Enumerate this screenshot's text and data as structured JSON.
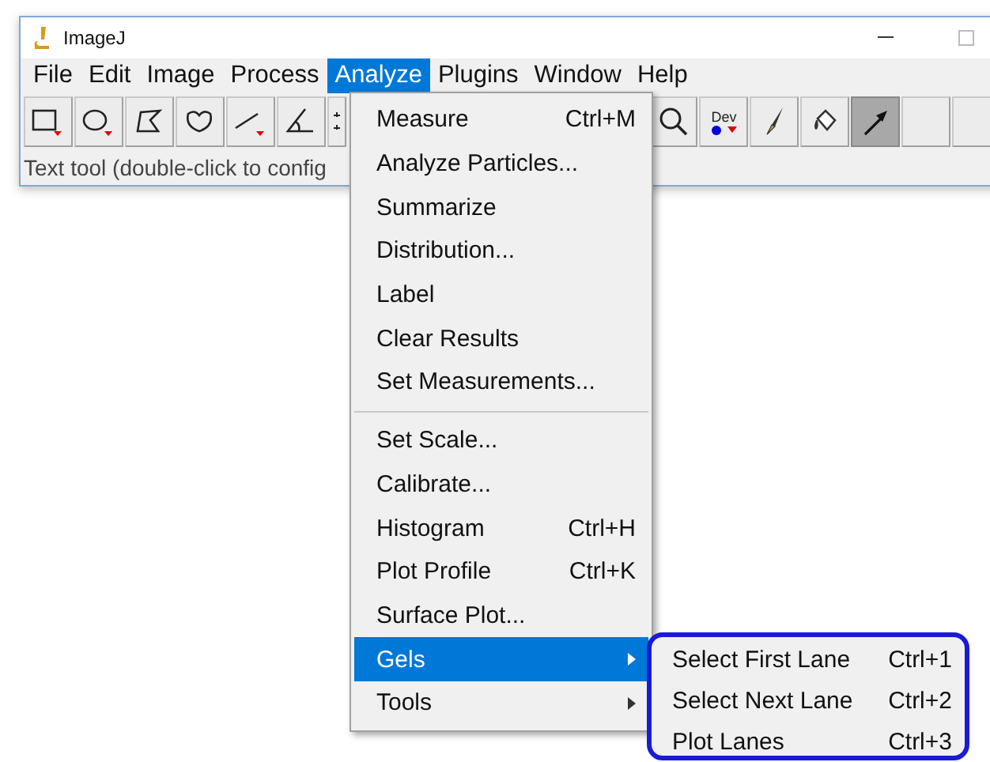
{
  "window": {
    "title": "ImageJ"
  },
  "menubar": [
    {
      "label": "File",
      "selected": false
    },
    {
      "label": "Edit",
      "selected": false
    },
    {
      "label": "Image",
      "selected": false
    },
    {
      "label": "Process",
      "selected": false
    },
    {
      "label": "Analyze",
      "selected": true
    },
    {
      "label": "Plugins",
      "selected": false
    },
    {
      "label": "Window",
      "selected": false
    },
    {
      "label": "Help",
      "selected": false
    }
  ],
  "toolbar": {
    "left_tools": [
      {
        "kind": "rectangle",
        "selected": false
      },
      {
        "kind": "oval",
        "selected": false
      },
      {
        "kind": "polygon",
        "selected": false
      },
      {
        "kind": "freehand",
        "selected": false
      },
      {
        "kind": "line",
        "selected": false
      },
      {
        "kind": "angle",
        "selected": false
      },
      {
        "kind": "point",
        "selected": false
      }
    ],
    "right_tools": [
      {
        "kind": "magnifier",
        "selected": false
      },
      {
        "kind": "dev",
        "label": "Dev",
        "selected": false
      },
      {
        "kind": "brush",
        "selected": false
      },
      {
        "kind": "fill",
        "selected": false
      },
      {
        "kind": "arrow",
        "selected": true
      },
      {
        "kind": "empty",
        "selected": false
      },
      {
        "kind": "empty",
        "selected": false
      }
    ]
  },
  "status_bar": {
    "text": "Text tool (double-click to config"
  },
  "menu": {
    "items": [
      {
        "kind": "item",
        "label": "Measure",
        "shortcut": "Ctrl+M",
        "selected": false
      },
      {
        "kind": "item",
        "label": "Analyze Particles...",
        "selected": false
      },
      {
        "kind": "item",
        "label": "Summarize",
        "selected": false
      },
      {
        "kind": "item",
        "label": "Distribution...",
        "selected": false
      },
      {
        "kind": "item",
        "label": "Label",
        "selected": false
      },
      {
        "kind": "item",
        "label": "Clear Results",
        "selected": false
      },
      {
        "kind": "item",
        "label": "Set Measurements...",
        "selected": false
      },
      {
        "kind": "separator"
      },
      {
        "kind": "item",
        "label": "Set Scale...",
        "selected": false
      },
      {
        "kind": "item",
        "label": "Calibrate...",
        "selected": false
      },
      {
        "kind": "item",
        "label": "Histogram",
        "shortcut": "Ctrl+H",
        "selected": false
      },
      {
        "kind": "item",
        "label": "Plot Profile",
        "shortcut": "Ctrl+K",
        "selected": false
      },
      {
        "kind": "item",
        "label": "Surface Plot...",
        "selected": false
      },
      {
        "kind": "submenu",
        "label": "Gels",
        "selected": true
      },
      {
        "kind": "submenu",
        "label": "Tools",
        "selected": false
      }
    ]
  },
  "submenu": {
    "items": [
      {
        "label": "Select First Lane",
        "shortcut": "Ctrl+1",
        "selected": false
      },
      {
        "label": "Select Next Lane",
        "shortcut": "Ctrl+2",
        "selected": false
      },
      {
        "label": "Plot Lanes",
        "shortcut": "Ctrl+3",
        "selected": false
      }
    ]
  }
}
